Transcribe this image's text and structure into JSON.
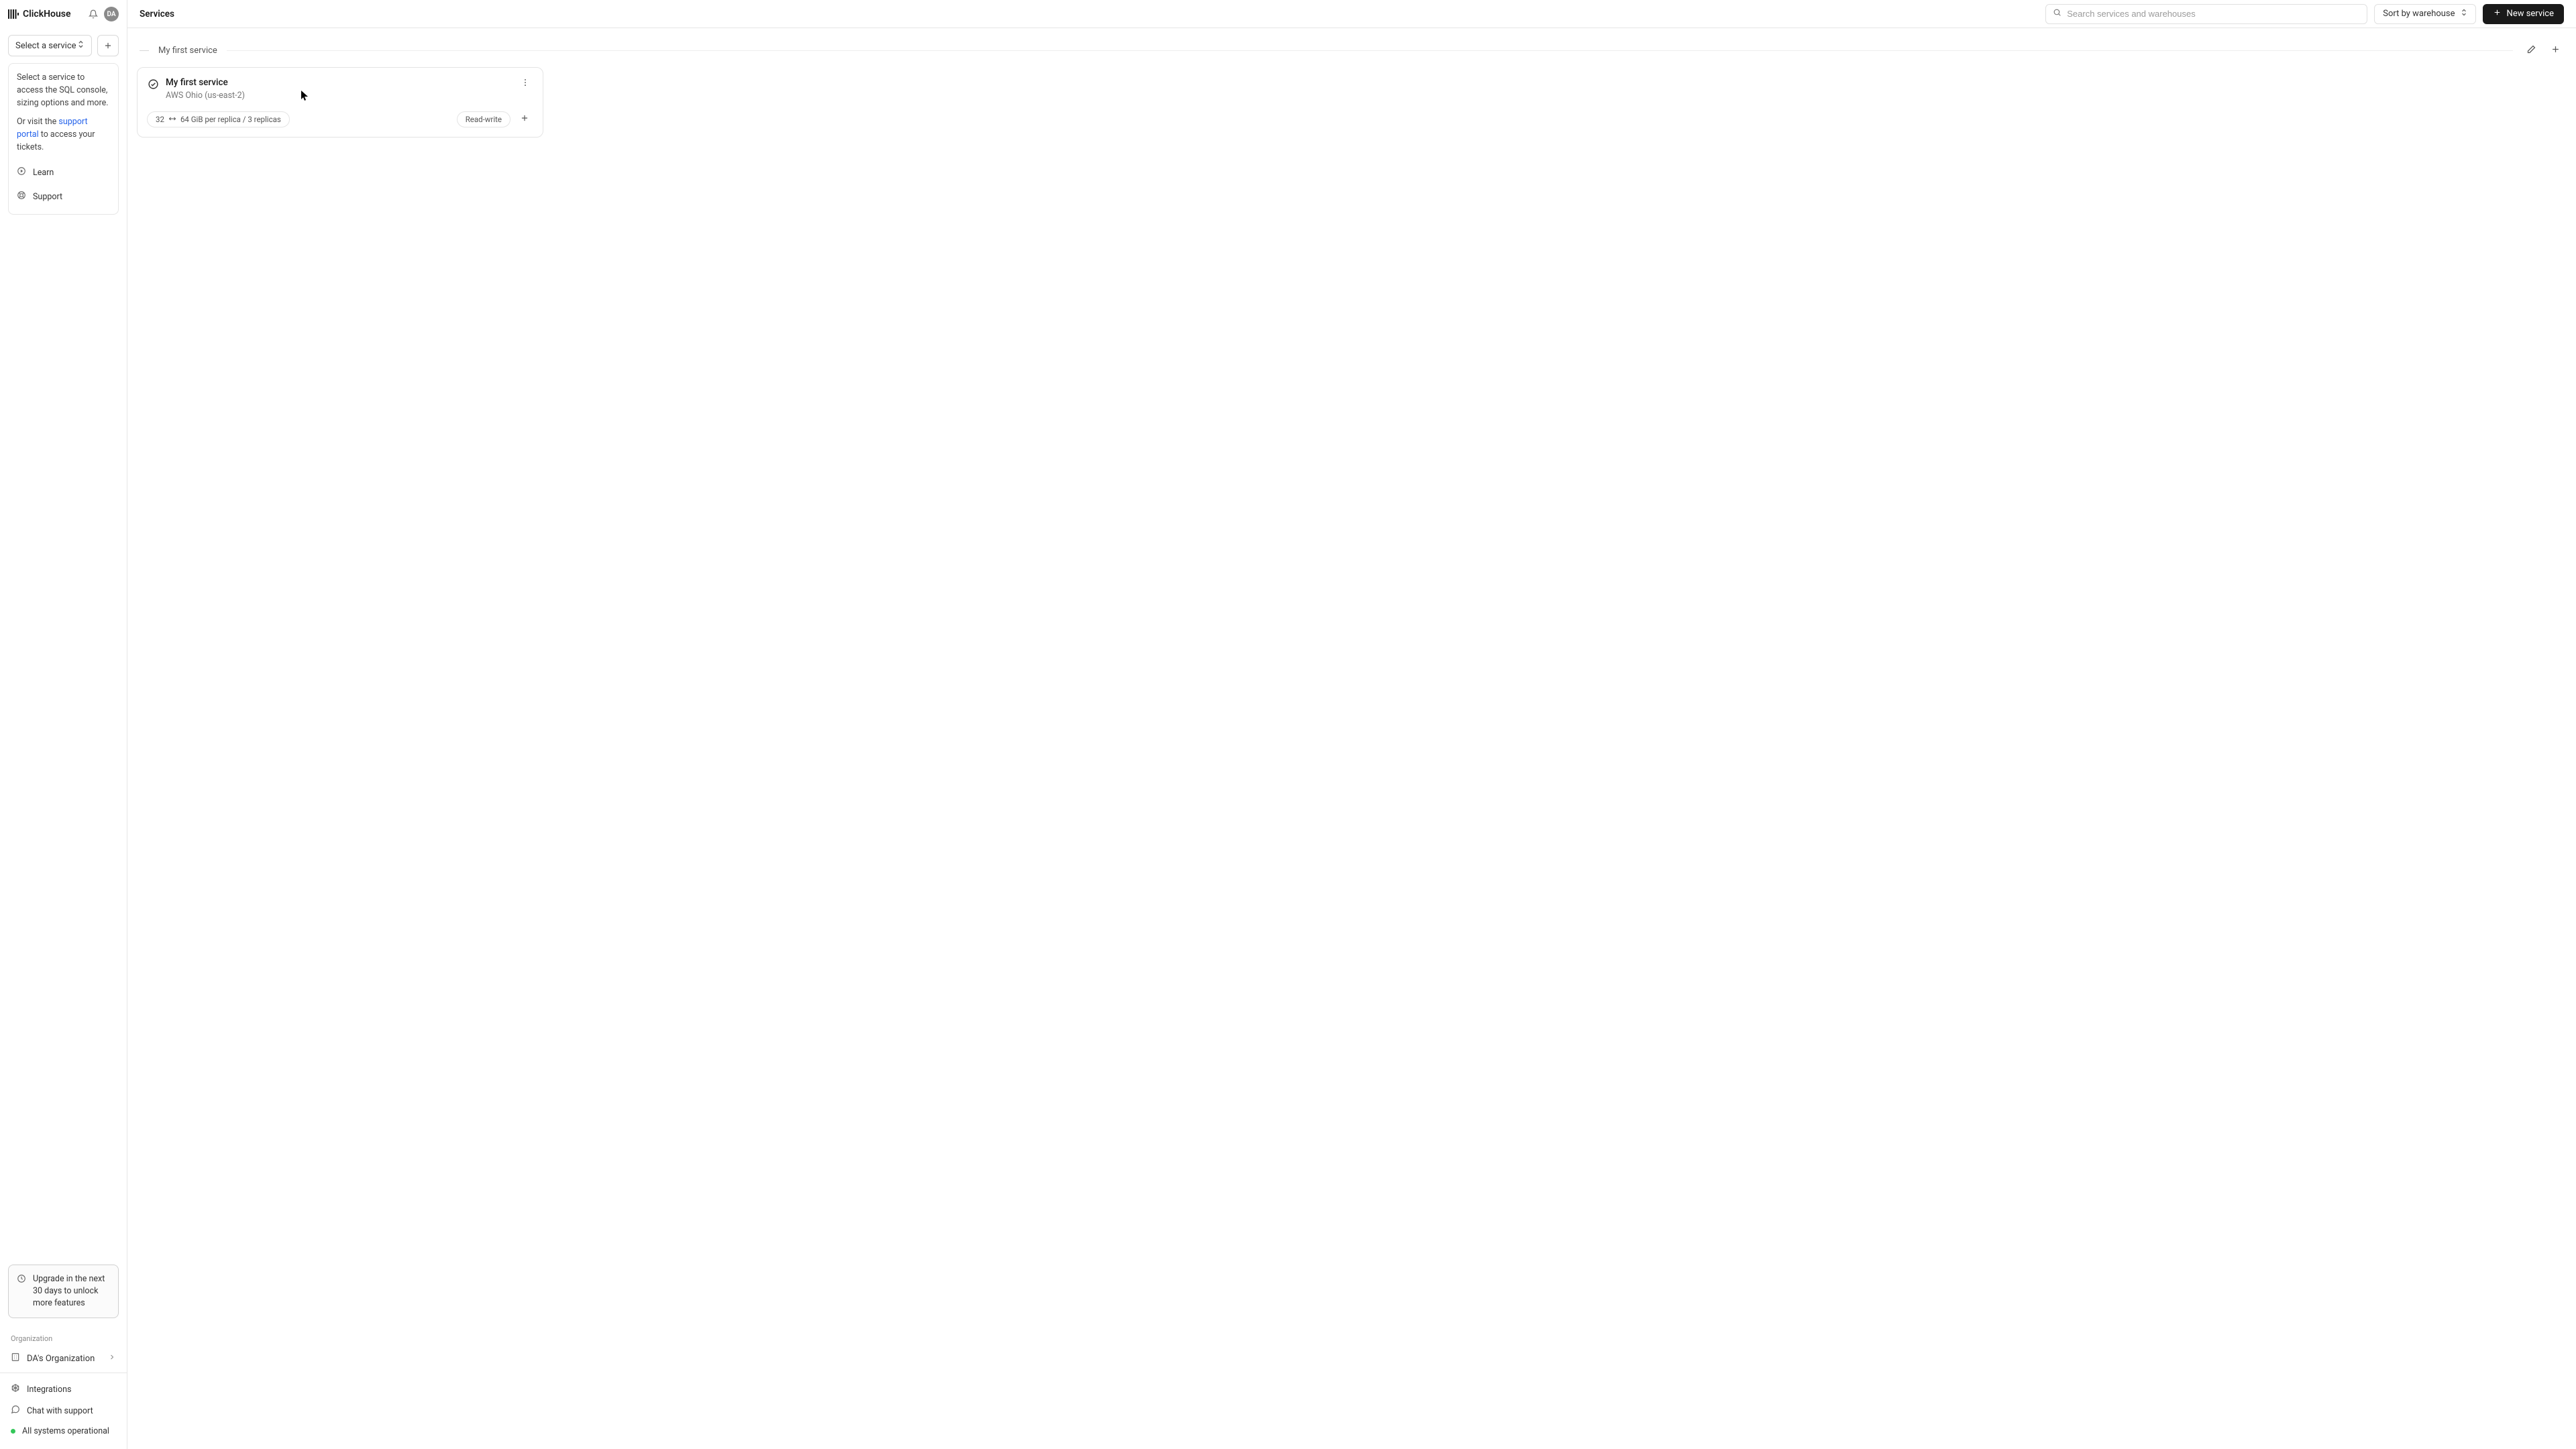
{
  "brand": "ClickHouse",
  "avatar_initials": "DA",
  "sidebar": {
    "select_service_label": "Select a service",
    "info_text_1": "Select a service to access the SQL console, sizing options and more.",
    "info_text_2a": "Or visit the ",
    "info_link": "support portal",
    "info_text_2b": " to access your tickets.",
    "learn_label": "Learn",
    "support_label": "Support",
    "upgrade_text": "Upgrade in the next 30 days to unlock more features",
    "org_section_label": "Organization",
    "org_name": "DA's Organization",
    "integrations_label": "Integrations",
    "chat_label": "Chat with support",
    "status_label": "All systems operational"
  },
  "topbar": {
    "title": "Services",
    "search_placeholder": "Search services and warehouses",
    "sort_label": "Sort by warehouse",
    "new_service_label": "New service"
  },
  "group": {
    "title": "My first service"
  },
  "service": {
    "name": "My first service",
    "region": "AWS Ohio (us-east-2)",
    "spec_min": "32",
    "spec_max": "64 GiB per replica / 3 replicas",
    "rw_label": "Read-write"
  }
}
